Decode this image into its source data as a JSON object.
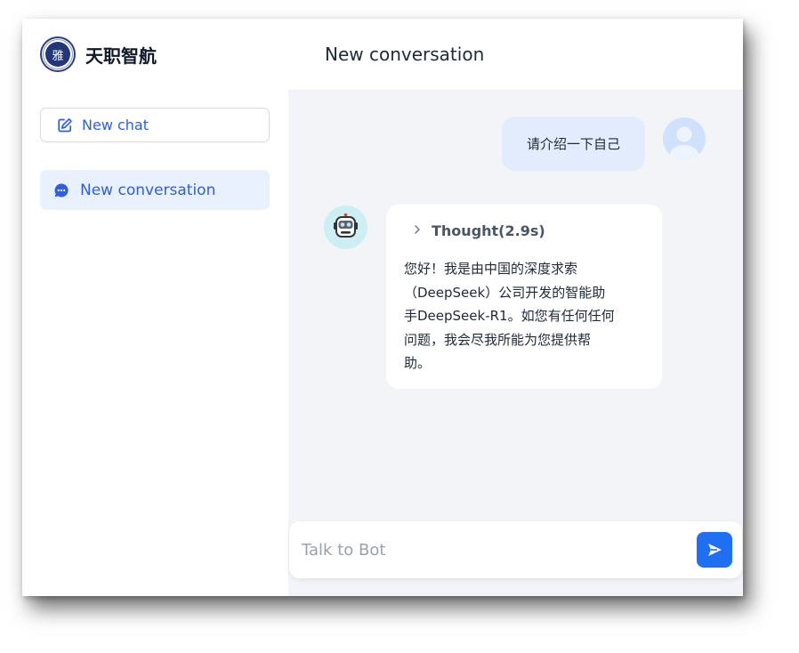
{
  "brand": {
    "name": "天职智航",
    "logo_text": "雅"
  },
  "sidebar": {
    "new_chat_label": "New chat",
    "conversations": [
      {
        "label": "New conversation",
        "active": true
      }
    ]
  },
  "header": {
    "title": "New conversation"
  },
  "messages": {
    "user": {
      "text": "请介绍一下自己"
    },
    "bot": {
      "thought_label": "Thought(2.9s)",
      "answer_lines": [
        "您好！我是由中国的深度求索",
        "（DeepSeek）公司开发的智能助",
        "手DeepSeek-R1。如您有任何任何",
        "问题，我会尽我所能为您提供帮",
        "助。"
      ]
    }
  },
  "composer": {
    "placeholder": "Talk to Bot",
    "value": ""
  },
  "icons": {
    "logo": "university-seal-icon",
    "new_chat": "edit-icon",
    "conversation": "chat-bubble-icon",
    "user_avatar": "user-avatar-icon",
    "bot_avatar": "robot-avatar-icon",
    "thought_toggle": "chevron-right-icon",
    "send": "send-icon"
  },
  "colors": {
    "accent": "#1e6ff2",
    "link": "#2f5fe0",
    "active_item_bg": "#eaf1fe",
    "user_bubble_bg": "#e3ecfc",
    "main_bg": "#f3f4f7"
  }
}
